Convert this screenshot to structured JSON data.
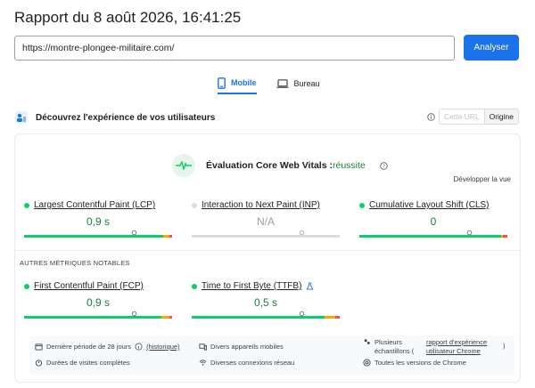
{
  "report": {
    "title": "Rapport du 8 août 2026, 16:41:25"
  },
  "search": {
    "url_value": "https://montre-plongee-militaire.com/",
    "analyze_label": "Analyser"
  },
  "tabs": [
    {
      "label": "Mobile",
      "icon": "phone-icon",
      "active": true
    },
    {
      "label": "Bureau",
      "icon": "laptop-icon",
      "active": false
    }
  ],
  "section": {
    "title": "Découvrez l'expérience de vos utilisateurs",
    "switch_options": [
      "Cette URL",
      "Origine"
    ],
    "switch_selected": "Origine"
  },
  "cwv": {
    "label": "Évaluation Core Web Vitals :",
    "result": "réussite",
    "expand_label": "Développer la vue"
  },
  "metrics": [
    {
      "name": "Largest Contentful Paint (LCP)",
      "value": "0,9 s",
      "status": "good",
      "color": "#0cce6b"
    },
    {
      "name": "Interaction to Next Paint (INP)",
      "value": "N/A",
      "status": "na",
      "color": "#dadce0"
    },
    {
      "name": "Cumulative Layout Shift (CLS)",
      "value": "0",
      "status": "good",
      "color": "#0cce6b"
    }
  ],
  "other_metrics": {
    "label": "AUTRES MÉTRIQUES NOTABLES",
    "items": [
      {
        "name": "First Contentful Paint (FCP)",
        "value": "0,9 s",
        "status": "good",
        "color": "#0cce6b"
      },
      {
        "name": "Time to First Byte (TTFB)",
        "value": "0,5 s",
        "status": "good",
        "color": "#0cce6b"
      }
    ]
  },
  "footer": {
    "period_prefix": "Dernière période de 28 jours",
    "history_link": "(historique)",
    "devices": "Divers appareils mobiles",
    "samples_prefix": "Plusieurs échantillons (",
    "samples_link": "rapport d'expérience utilisateur Chrome",
    "samples_suffix": ")",
    "durations": "Durées de visites complètes",
    "connections": "Diverses connexions réseau",
    "chrome_versions": "Toutes les versions de Chrome"
  },
  "colors": {
    "accent": "#1a73e8",
    "good": "#0cce6b",
    "needs_improvement": "#ffa400",
    "poor": "#ff4e42",
    "pass_text": "#188038"
  }
}
